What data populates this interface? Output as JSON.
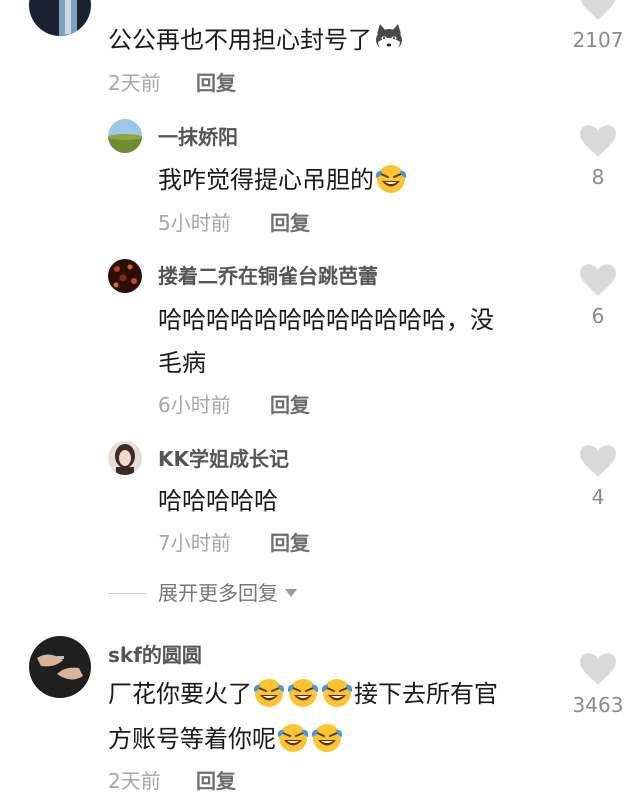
{
  "comments": [
    {
      "text": "公公再也不用担心封号了",
      "emoji": "husky-emoji",
      "time": "2天前",
      "reply_label": "回复",
      "likes": "2107"
    },
    {
      "text_part1": "厂花你要火了",
      "text_part2": "接下去所有官",
      "text_part3": "方账号等着你呢",
      "emoji": "laughing-tears-emoji",
      "username": "skf的圆圆",
      "time": "2天前",
      "reply_label": "回复",
      "likes": "3463"
    }
  ],
  "replies": [
    {
      "username": "一抹娇阳",
      "text": "我咋觉得提心吊胆的",
      "emoji": "laughing-tears-emoji",
      "time": "5小时前",
      "reply_label": "回复",
      "likes": "8"
    },
    {
      "username": "搂着二乔在铜雀台跳芭蕾",
      "text_line1": "哈哈哈哈哈哈哈哈哈哈哈哈，没",
      "text_line2": "毛病",
      "time": "6小时前",
      "reply_label": "回复",
      "likes": "6"
    },
    {
      "username": "KK学姐成长记",
      "text": "哈哈哈哈哈",
      "time": "7小时前",
      "reply_label": "回复",
      "likes": "4"
    }
  ],
  "expand_label": "展开更多回复",
  "icons": {
    "like": "heart-icon",
    "expand": "caret-down-icon"
  },
  "colors": {
    "heart": "#d9d9d9",
    "username": "#555555",
    "meta": "#a6a6a6"
  }
}
